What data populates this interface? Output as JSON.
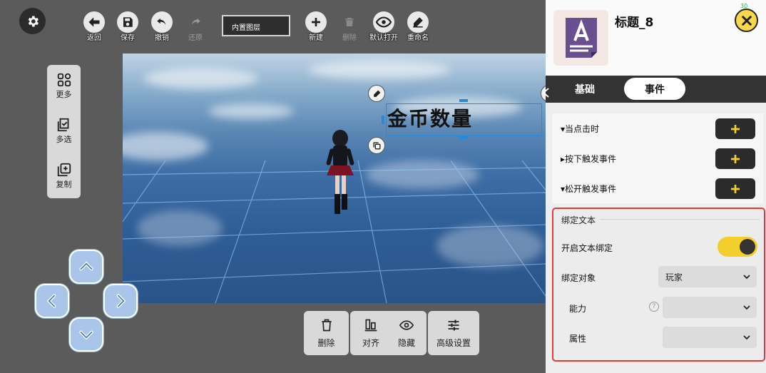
{
  "toolbar": {
    "back": "返回",
    "save": "保存",
    "undo": "撤销",
    "redo": "还原",
    "layer_select": "内置图层",
    "new": "新建",
    "delete": "删除",
    "default_open": "默认打开",
    "rename": "重命名"
  },
  "canvas": {
    "title_text": "金币数量"
  },
  "left_tools": {
    "more": "更多",
    "multi_select": "多选",
    "copy": "复制"
  },
  "bottom_tools": {
    "delete": "删除",
    "align": "对齐",
    "hide": "隐藏",
    "advanced": "高级设置"
  },
  "panel": {
    "title": "标题_8",
    "fps": "30",
    "tabs": [
      {
        "label": "基础",
        "active": false
      },
      {
        "label": "事件",
        "active": true
      }
    ],
    "events": [
      {
        "label": "▾当点击时"
      },
      {
        "label": "▸按下触发事件"
      },
      {
        "label": "▾松开触发事件"
      }
    ],
    "add_symbol": "+",
    "binding": {
      "section_title": "绑定文本",
      "enable_label": "开启文本绑定",
      "enable_on": true,
      "target_label": "绑定对象",
      "target_value": "玩家",
      "ability_label": "能力",
      "ability_value": "",
      "help_symbol": "?",
      "attribute_label": "属性",
      "attribute_value": ""
    }
  },
  "colors": {
    "accent_yellow": "#f3cf2b",
    "highlight_red": "#e23a3a",
    "selection_blue": "#2a88d8"
  }
}
